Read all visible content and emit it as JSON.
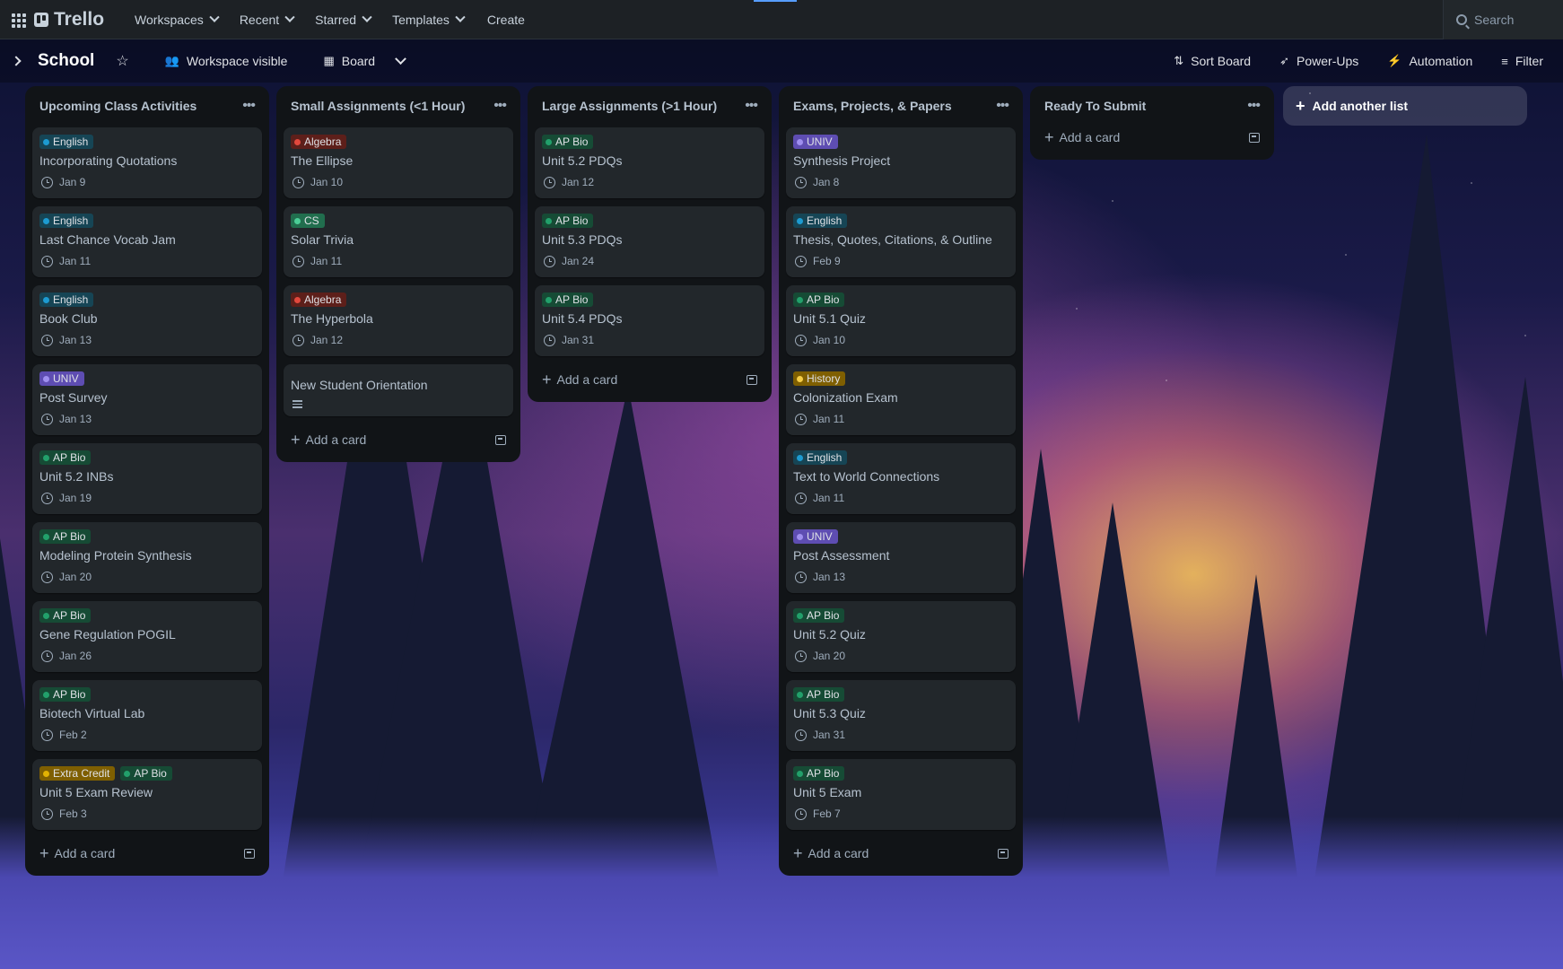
{
  "topnav": {
    "app_name": "Trello",
    "items": [
      {
        "label": "Workspaces"
      },
      {
        "label": "Recent"
      },
      {
        "label": "Starred"
      },
      {
        "label": "Templates"
      }
    ],
    "create_label": "Create",
    "search_placeholder": "Search"
  },
  "board": {
    "title": "School",
    "visibility_label": "Workspace visible",
    "view_label": "Board",
    "actions": {
      "sort": "Sort Board",
      "powerups": "Power-Ups",
      "automation": "Automation",
      "filter": "Filter"
    }
  },
  "label_colors": {
    "English": "#1d9bd1",
    "Algebra": "#e2483d",
    "CS": "#4bce97",
    "AP Bio": "#22a06b",
    "UNIV": "#9f8fef",
    "History": "#f5cd47",
    "Extra Credit": "#e2b203"
  },
  "label_bg": {
    "English": "#164555",
    "Algebra": "#5d1f1a",
    "CS": "#216e4e",
    "AP Bio": "#164b35",
    "UNIV": "#5e4db2",
    "History": "#7f5f01",
    "Extra Credit": "#7f5f01"
  },
  "lists": [
    {
      "title": "Upcoming Class Activities",
      "cards": [
        {
          "labels": [
            "English"
          ],
          "title": "Incorporating Quotations",
          "due": "Jan 9"
        },
        {
          "labels": [
            "English"
          ],
          "title": "Last Chance Vocab Jam",
          "due": "Jan 11"
        },
        {
          "labels": [
            "English"
          ],
          "title": "Book Club",
          "due": "Jan 13"
        },
        {
          "labels": [
            "UNIV"
          ],
          "title": "Post Survey",
          "due": "Jan 13"
        },
        {
          "labels": [
            "AP Bio"
          ],
          "title": "Unit 5.2 INBs",
          "due": "Jan 19"
        },
        {
          "labels": [
            "AP Bio"
          ],
          "title": "Modeling Protein Synthesis",
          "due": "Jan 20"
        },
        {
          "labels": [
            "AP Bio"
          ],
          "title": "Gene Regulation POGIL",
          "due": "Jan 26"
        },
        {
          "labels": [
            "AP Bio"
          ],
          "title": "Biotech Virtual Lab",
          "due": "Feb 2"
        },
        {
          "labels": [
            "Extra Credit",
            "AP Bio"
          ],
          "title": "Unit 5 Exam Review",
          "due": "Feb 3"
        }
      ],
      "add_label": "Add a card"
    },
    {
      "title": "Small Assignments (<1 Hour)",
      "cards": [
        {
          "labels": [
            "Algebra"
          ],
          "title": "The Ellipse",
          "due": "Jan 10"
        },
        {
          "labels": [
            "CS"
          ],
          "title": "Solar Trivia",
          "due": "Jan 11"
        },
        {
          "labels": [
            "Algebra"
          ],
          "title": "The Hyperbola",
          "due": "Jan 12"
        },
        {
          "labels": [],
          "title": "New Student Orientation",
          "due": null,
          "has_description": true
        }
      ],
      "add_label": "Add a card"
    },
    {
      "title": "Large Assignments (>1 Hour)",
      "cards": [
        {
          "labels": [
            "AP Bio"
          ],
          "title": "Unit 5.2 PDQs",
          "due": "Jan 12"
        },
        {
          "labels": [
            "AP Bio"
          ],
          "title": "Unit 5.3 PDQs",
          "due": "Jan 24"
        },
        {
          "labels": [
            "AP Bio"
          ],
          "title": "Unit 5.4 PDQs",
          "due": "Jan 31"
        }
      ],
      "add_label": "Add a card"
    },
    {
      "title": "Exams, Projects, & Papers",
      "cards": [
        {
          "labels": [
            "UNIV"
          ],
          "title": "Synthesis Project",
          "due": "Jan 8"
        },
        {
          "labels": [
            "English"
          ],
          "title": "Thesis, Quotes, Citations, & Outline",
          "due": "Feb 9"
        },
        {
          "labels": [
            "AP Bio"
          ],
          "title": "Unit 5.1 Quiz",
          "due": "Jan 10"
        },
        {
          "labels": [
            "History"
          ],
          "title": "Colonization Exam",
          "due": "Jan 11"
        },
        {
          "labels": [
            "English"
          ],
          "title": "Text to World Connections",
          "due": "Jan 11"
        },
        {
          "labels": [
            "UNIV"
          ],
          "title": "Post Assessment",
          "due": "Jan 13"
        },
        {
          "labels": [
            "AP Bio"
          ],
          "title": "Unit 5.2 Quiz",
          "due": "Jan 20"
        },
        {
          "labels": [
            "AP Bio"
          ],
          "title": "Unit 5.3 Quiz",
          "due": "Jan 31"
        },
        {
          "labels": [
            "AP Bio"
          ],
          "title": "Unit 5 Exam",
          "due": "Feb 7"
        }
      ],
      "add_label": "Add a card"
    },
    {
      "title": "Ready To Submit",
      "cards": [],
      "add_label": "Add a card"
    }
  ],
  "add_list_label": "Add another list"
}
